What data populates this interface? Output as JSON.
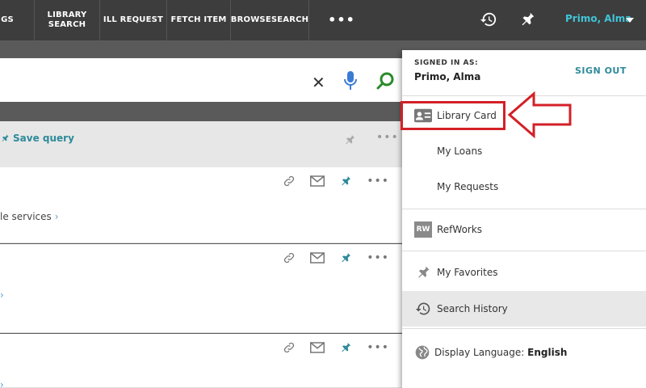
{
  "nav": {
    "items": [
      {
        "label": "GS"
      },
      {
        "label": "LIBRARY SEARCH"
      },
      {
        "label": "ILL REQUEST"
      },
      {
        "label": "FETCH ITEM"
      },
      {
        "label": "BROWSESEARCH"
      }
    ],
    "more": "•••",
    "user_name": "Primo, Alma"
  },
  "search": {
    "clear": "✕"
  },
  "results": {
    "save_query": "Save query",
    "more": "•••",
    "card1_text": "le services",
    "chevron": "›"
  },
  "menu": {
    "signed_in_label": "SIGNED IN AS:",
    "signed_in_name": "Primo, Alma",
    "sign_out": "SIGN OUT",
    "items": [
      {
        "label": "Library Card",
        "icon": "library-card-icon"
      },
      {
        "label": "My Loans"
      },
      {
        "label": "My Requests"
      },
      {
        "label": "RefWorks",
        "icon": "refworks-icon",
        "badge": "RW"
      },
      {
        "label": "My Favorites",
        "icon": "pin-icon"
      },
      {
        "label": "Search History",
        "icon": "history-icon",
        "active": true
      },
      {
        "label_prefix": "Display Language:",
        "label_value": "English",
        "icon": "globe-icon"
      }
    ]
  },
  "colors": {
    "accent": "#41c4d8",
    "link": "#2e8a99",
    "highlight": "#d32027",
    "search_go": "#2a8a2a",
    "mic": "#3a7bd5"
  }
}
